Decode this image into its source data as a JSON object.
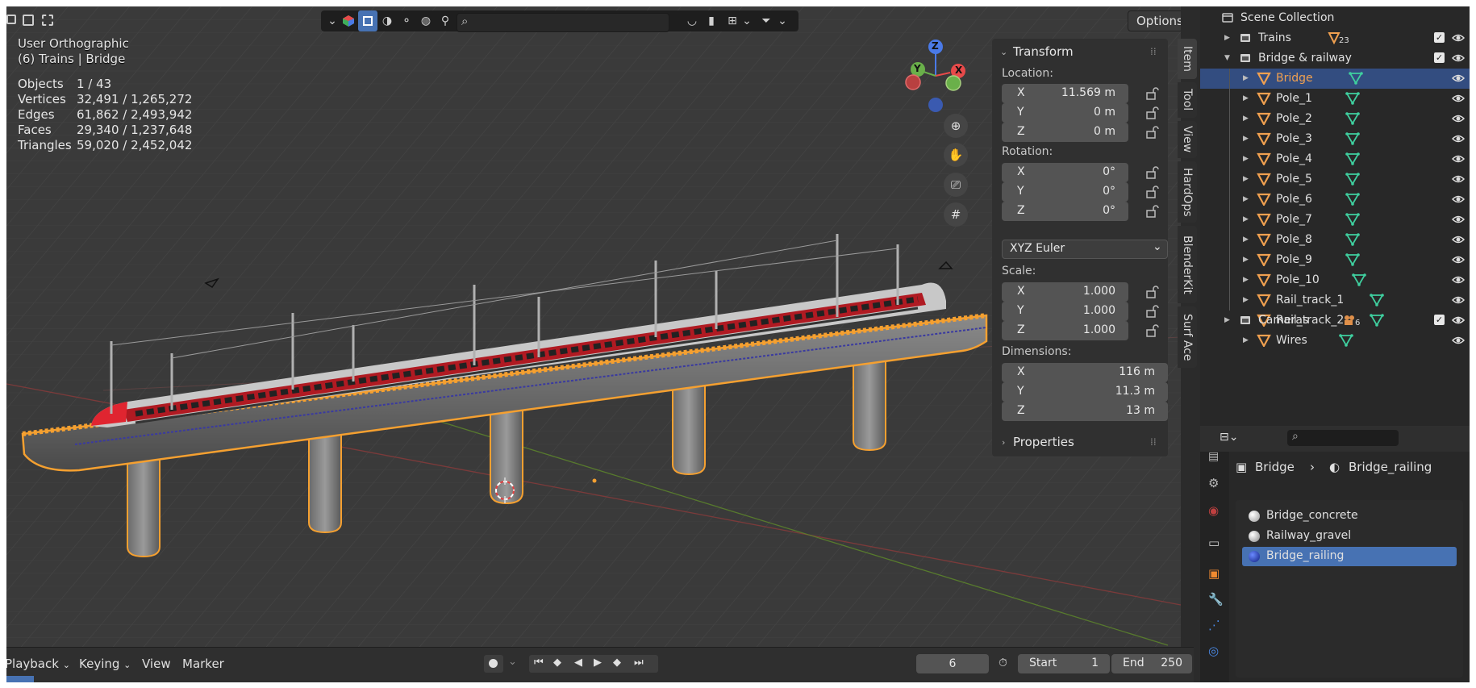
{
  "viewport": {
    "view_name": "User Orthographic",
    "context": "(6) Trains | Bridge",
    "stats": [
      {
        "label": "Objects",
        "value": "1 / 43"
      },
      {
        "label": "Vertices",
        "value": "32,491 / 1,265,272"
      },
      {
        "label": "Edges",
        "value": "61,862 / 2,493,942"
      },
      {
        "label": "Faces",
        "value": "29,340 / 1,237,648"
      },
      {
        "label": "Triangles",
        "value": "59,020 / 2,452,042"
      }
    ],
    "options_label": "Options",
    "gizmo_axis_z": "Z",
    "gizmo_axis_y": "Y",
    "gizmo_axis_x": "X"
  },
  "npanel": {
    "transform_title": "Transform",
    "location_label": "Location:",
    "location": [
      {
        "axis": "X",
        "value": "11.569 m"
      },
      {
        "axis": "Y",
        "value": "0 m"
      },
      {
        "axis": "Z",
        "value": "0 m"
      }
    ],
    "rotation_label": "Rotation:",
    "rotation": [
      {
        "axis": "X",
        "value": "0°"
      },
      {
        "axis": "Y",
        "value": "0°"
      },
      {
        "axis": "Z",
        "value": "0°"
      }
    ],
    "rotation_mode": "XYZ Euler",
    "scale_label": "Scale:",
    "scale": [
      {
        "axis": "X",
        "value": "1.000"
      },
      {
        "axis": "Y",
        "value": "1.000"
      },
      {
        "axis": "Z",
        "value": "1.000"
      }
    ],
    "dimensions_label": "Dimensions:",
    "dimensions": [
      {
        "axis": "X",
        "value": "116 m"
      },
      {
        "axis": "Y",
        "value": "11.3 m"
      },
      {
        "axis": "Z",
        "value": "13 m"
      }
    ],
    "properties_title": "Properties",
    "tabs": [
      "Item",
      "Tool",
      "View",
      "HardOps",
      "BlenderKit",
      "Surf Ace"
    ]
  },
  "timeline": {
    "menus": [
      "Playback",
      "Keying",
      "View",
      "Marker"
    ],
    "current_frame": "6",
    "start_label": "Start",
    "start_value": "1",
    "end_label": "End",
    "end_value": "250"
  },
  "outliner": {
    "root": "Scene Collection",
    "items": [
      {
        "name": "Trains",
        "kind": "collection",
        "badge": "23",
        "badge_icon": "object-data-icon",
        "indent": 1,
        "expanded": false,
        "check": true
      },
      {
        "name": "Bridge & railway",
        "kind": "collection",
        "badge": "",
        "indent": 1,
        "expanded": true,
        "check": true
      },
      {
        "name": "Bridge",
        "kind": "mesh",
        "indent": 2,
        "selected": true
      },
      {
        "name": "Pole_1",
        "kind": "mesh",
        "indent": 2
      },
      {
        "name": "Pole_2",
        "kind": "mesh",
        "indent": 2
      },
      {
        "name": "Pole_3",
        "kind": "mesh",
        "indent": 2
      },
      {
        "name": "Pole_4",
        "kind": "mesh",
        "indent": 2
      },
      {
        "name": "Pole_5",
        "kind": "mesh",
        "indent": 2
      },
      {
        "name": "Pole_6",
        "kind": "mesh",
        "indent": 2
      },
      {
        "name": "Pole_7",
        "kind": "mesh",
        "indent": 2
      },
      {
        "name": "Pole_8",
        "kind": "mesh",
        "indent": 2
      },
      {
        "name": "Pole_9",
        "kind": "mesh",
        "indent": 2
      },
      {
        "name": "Pole_10",
        "kind": "mesh",
        "indent": 2
      },
      {
        "name": "Rail_track_1",
        "kind": "mesh",
        "indent": 2
      },
      {
        "name": "Rail_track_2",
        "kind": "mesh",
        "indent": 2
      },
      {
        "name": "Wires",
        "kind": "mesh",
        "indent": 2
      },
      {
        "name": "Cameras",
        "kind": "collection",
        "badge": "6",
        "badge_icon": "camera-data-icon",
        "indent": 1,
        "expanded": false,
        "check": true
      }
    ]
  },
  "properties": {
    "breadcrumb_object": "Bridge",
    "breadcrumb_material": "Bridge_railing",
    "materials": [
      {
        "name": "Bridge_concrete",
        "color": "#d8d8d8"
      },
      {
        "name": "Railway_gravel",
        "color": "#cfcfcf"
      },
      {
        "name": "Bridge_railing",
        "color": "#1f3fb0",
        "selected": true
      }
    ]
  },
  "colors": {
    "accent": "#4772b3",
    "selection_outline": "#f5a030",
    "object_icon": "#f0a050",
    "mesh_data_icon": "#3fcf9f"
  }
}
